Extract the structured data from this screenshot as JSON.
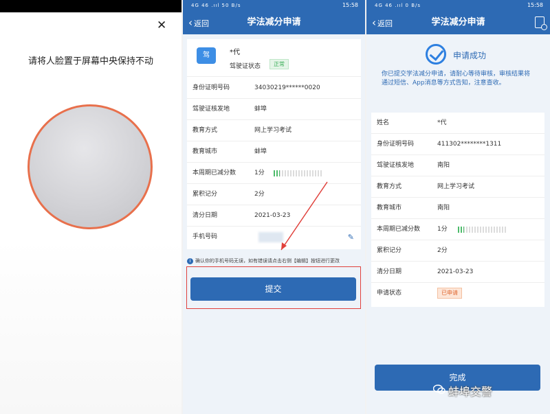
{
  "screen1": {
    "close_icon": "close-icon",
    "prompt": "请将人脸置于屏幕中央保持不动"
  },
  "screen2": {
    "status": {
      "left": "4G 46 .ııl 50 B/s",
      "right": "15:58"
    },
    "nav": {
      "back": "返回",
      "title": "学法减分申请"
    },
    "license": {
      "name": "*代",
      "status_label": "驾驶证状态",
      "status_value": "正常",
      "icon_text": "驾"
    },
    "rows": [
      {
        "key": "身份证明号码",
        "value": "34030219******0020"
      },
      {
        "key": "驾驶证核发地",
        "value": "蚌埠"
      },
      {
        "key": "教育方式",
        "value": "网上学习考试"
      },
      {
        "key": "教育城市",
        "value": "蚌埠"
      },
      {
        "key": "本周期已减分数",
        "value": "1分",
        "progress": 0.125
      },
      {
        "key": "累积记分",
        "value": "2分"
      },
      {
        "key": "清分日期",
        "value": "2021-03-23"
      },
      {
        "key": "手机号码",
        "value": ""
      }
    ],
    "hint": "确认你的手机号码无误，如有错误请点击右侧【编辑】按钮进行更改",
    "submit": "提交"
  },
  "screen3": {
    "status": {
      "left": "4G 46 .ııl 0 B/s",
      "right": "15:58"
    },
    "nav": {
      "back": "返回",
      "title": "学法减分申请"
    },
    "success_title": "申请成功",
    "success_msg": "你已提交学法减分申请，请耐心等待审核，审核结果将通过短信、App消息等方式告知，注意查收。",
    "rows": [
      {
        "key": "姓名",
        "value": "*代"
      },
      {
        "key": "身份证明号码",
        "value": "411302********1311"
      },
      {
        "key": "驾驶证核发地",
        "value": "南阳"
      },
      {
        "key": "教育方式",
        "value": "网上学习考试"
      },
      {
        "key": "教育城市",
        "value": "南阳"
      },
      {
        "key": "本周期已减分数",
        "value": "1分",
        "progress": 0.125
      },
      {
        "key": "累积记分",
        "value": "2分"
      },
      {
        "key": "清分日期",
        "value": "2021-03-23"
      },
      {
        "key": "申请状态",
        "value": "已申请"
      }
    ],
    "done": "完成"
  },
  "watermark": "蚌埠交警",
  "colors": {
    "primary": "#2d6ab4",
    "face_ring": "#e8704c",
    "highlight": "#e0403b",
    "ok": "#3cae5a",
    "applied": "#e06a35"
  }
}
